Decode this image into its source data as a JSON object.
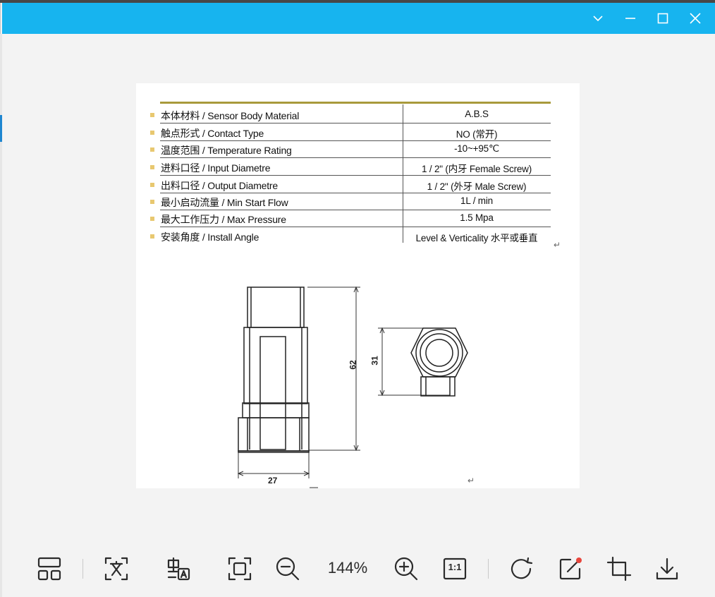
{
  "window": {
    "controls": {
      "collapse": "chevron-down-icon",
      "minimize": "minimize-icon",
      "maximize": "maximize-icon",
      "close": "close-icon"
    },
    "accent_color": "#17b4ef"
  },
  "document": {
    "specs": [
      {
        "label": "本体材料 / Sensor Body Material",
        "value": "A.B.S"
      },
      {
        "label": "触点形式 / Contact Type",
        "value": "NO (常开)"
      },
      {
        "label": "温度范围 / Temperature Rating",
        "value": "-10~+95℃"
      },
      {
        "label": "进料口径 / Input Diametre",
        "value": "1 / 2\" (内牙 Female Screw)"
      },
      {
        "label": "出料口径 / Output Diametre",
        "value": "1 / 2\" (外牙 Male Screw)"
      },
      {
        "label": "最小启动流量 / Min Start Flow",
        "value": "1L / min"
      },
      {
        "label": "最大工作压力 / Max Pressure",
        "value": "1.5 Mpa"
      },
      {
        "label": "安装角度 / Install Angle",
        "value": "Level & Verticality 水平或垂直"
      }
    ],
    "return_mark": "↵",
    "drawing": {
      "height_dim": "62",
      "width_dim": "27",
      "side_dim": "31"
    }
  },
  "toolbar": {
    "items": [
      "layout-icon",
      "text-extract-icon",
      "translate-icon",
      "fit-screen-icon",
      "zoom-out-icon",
      "zoom-in-icon",
      "actual-size-icon",
      "rotate-icon",
      "edit-icon",
      "crop-icon",
      "download-icon"
    ],
    "zoom_level": "144%",
    "actual_size_label": "1:1",
    "edit_badge_color": "#e8453c"
  }
}
